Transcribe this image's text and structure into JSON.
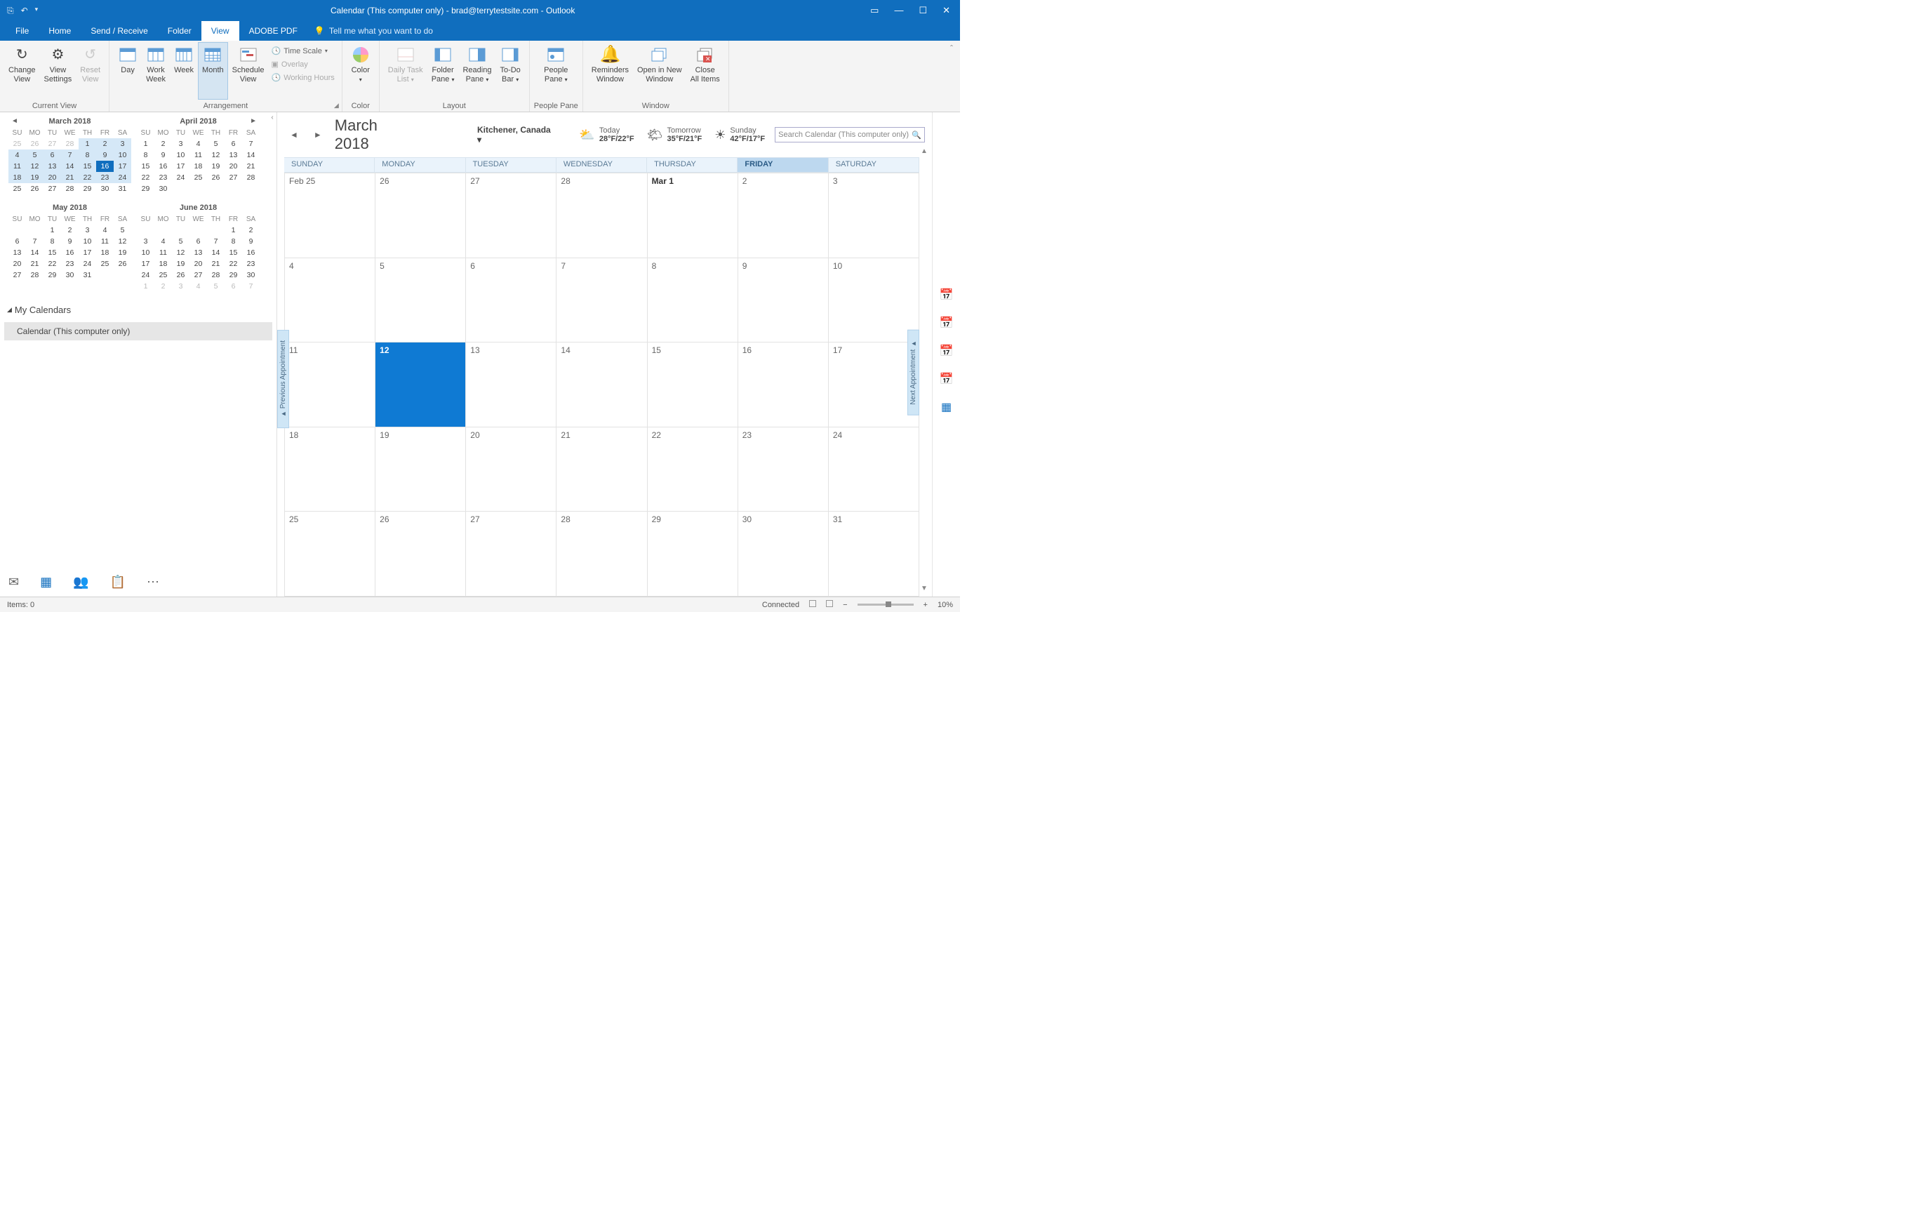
{
  "title": "Calendar (This computer only) - brad@terrytestsite.com  -  Outlook",
  "tabs": {
    "file": "File",
    "home": "Home",
    "sendrecv": "Send / Receive",
    "folder": "Folder",
    "view": "View",
    "adobe": "ADOBE PDF"
  },
  "tellme": "Tell me what you want to do",
  "ribbon": {
    "currentview": {
      "change": "Change\nView",
      "settings": "View\nSettings",
      "reset": "Reset\nView",
      "label": "Current View"
    },
    "arrangement": {
      "day": "Day",
      "workweek": "Work\nWeek",
      "week": "Week",
      "month": "Month",
      "schedule": "Schedule\nView",
      "timescale": "Time Scale",
      "overlay": "Overlay",
      "workhours": "Working Hours",
      "label": "Arrangement"
    },
    "color": {
      "btn": "Color",
      "label": "Color"
    },
    "layout": {
      "daily": "Daily Task\nList",
      "folder": "Folder\nPane",
      "reading": "Reading\nPane",
      "todo": "To-Do\nBar",
      "label": "Layout"
    },
    "peoplepane": {
      "btn": "People\nPane",
      "label": "People Pane"
    },
    "window": {
      "reminders": "Reminders\nWindow",
      "openinnew": "Open in New\nWindow",
      "closeall": "Close\nAll Items",
      "label": "Window"
    }
  },
  "minical_titles": [
    "March 2018",
    "April 2018",
    "May 2018",
    "June 2018"
  ],
  "dayheaders": [
    "SU",
    "MO",
    "TU",
    "WE",
    "TH",
    "FR",
    "SA"
  ],
  "mycals": "My Calendars",
  "calitem": "Calendar (This computer only)",
  "bigmonth": "March 2018",
  "location": "Kitchener, Canada",
  "weather": [
    {
      "label": "Today",
      "temp": "28°F/22°F"
    },
    {
      "label": "Tomorrow",
      "temp": "35°F/21°F"
    },
    {
      "label": "Sunday",
      "temp": "42°F/17°F"
    }
  ],
  "search_ph": "Search Calendar (This computer only)",
  "weekday_full": [
    "SUNDAY",
    "MONDAY",
    "TUESDAY",
    "WEDNESDAY",
    "THURSDAY",
    "FRIDAY",
    "SATURDAY"
  ],
  "weekday_today_idx": 5,
  "gridcells": [
    "Feb 25",
    "26",
    "27",
    "28",
    "Mar 1",
    "2",
    "3",
    "4",
    "5",
    "6",
    "7",
    "8",
    "9",
    "10",
    "11",
    "12",
    "13",
    "14",
    "15",
    "16",
    "17",
    "18",
    "19",
    "20",
    "21",
    "22",
    "23",
    "24",
    "25",
    "26",
    "27",
    "28",
    "29",
    "30",
    "31"
  ],
  "grid_today_idx": 15,
  "grid_bold_idx": 4,
  "prevappt": "Previous Appointment",
  "nextappt": "Next Appointment",
  "status_items": "Items: 0",
  "status_conn": "Connected",
  "zoom": "10%",
  "minical_data": [
    {
      "lead": 4,
      "prev_tail": [
        25,
        26,
        27,
        28
      ],
      "days": 31,
      "today": 16,
      "hl": [
        1,
        2,
        3,
        4,
        5,
        6,
        7,
        8,
        9,
        10,
        11,
        12,
        13,
        14,
        15,
        17,
        18,
        19,
        20,
        21,
        22,
        23,
        24
      ]
    },
    {
      "lead": 0,
      "prev_tail": [],
      "days": 30,
      "today": 0,
      "hl": []
    },
    {
      "lead": 2,
      "prev_tail": [],
      "days": 31,
      "today": 0,
      "hl": []
    },
    {
      "lead": 5,
      "prev_tail": [],
      "days": 30,
      "today": 0,
      "hl": [],
      "next_head": 7
    }
  ]
}
